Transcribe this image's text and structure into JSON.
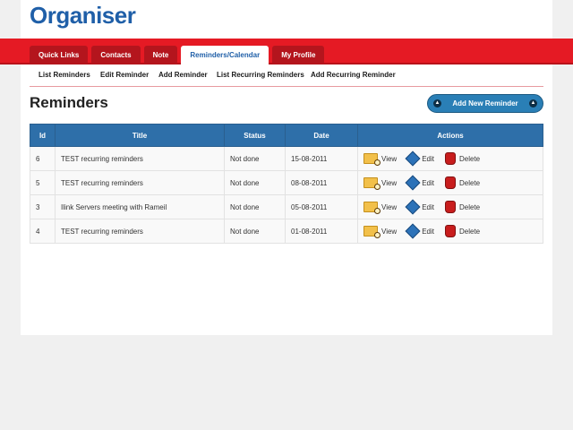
{
  "app": {
    "logo": "Organiser"
  },
  "tabs": [
    {
      "label": "Quick Links"
    },
    {
      "label": "Contacts"
    },
    {
      "label": "Note"
    },
    {
      "label": "Reminders/Calendar",
      "active": true
    },
    {
      "label": "My Profile"
    }
  ],
  "subnav": [
    {
      "label": "List Reminders"
    },
    {
      "label": "Edit Reminder"
    },
    {
      "label": "Add Reminder"
    },
    {
      "label": "List Recurring Reminders"
    },
    {
      "label": "Add Recurring Reminder"
    }
  ],
  "main": {
    "title": "Reminders",
    "add_button": "Add New Reminder"
  },
  "table": {
    "headers": [
      "Id",
      "Title",
      "Status",
      "Date",
      "Actions"
    ],
    "rows": [
      {
        "id": "6",
        "title": "TEST recurring reminders",
        "status": "Not done",
        "date": "15-08-2011"
      },
      {
        "id": "5",
        "title": "TEST recurring reminders",
        "status": "Not done",
        "date": "08-08-2011"
      },
      {
        "id": "3",
        "title": "Ilink Servers meeting with Rameil",
        "status": "Not done",
        "date": "05-08-2011"
      },
      {
        "id": "4",
        "title": "TEST recurring reminders",
        "status": "Not done",
        "date": "01-08-2011"
      }
    ],
    "actions": {
      "view": "View",
      "edit": "Edit",
      "delete": "Delete"
    }
  },
  "colors": {
    "brand_blue": "#1f5fa8",
    "nav_red": "#e51a24",
    "header_blue": "#2e6fa9"
  },
  "icons": {
    "view": "folder-view-icon",
    "edit": "pencil-edit-icon",
    "delete": "hand-delete-icon"
  }
}
